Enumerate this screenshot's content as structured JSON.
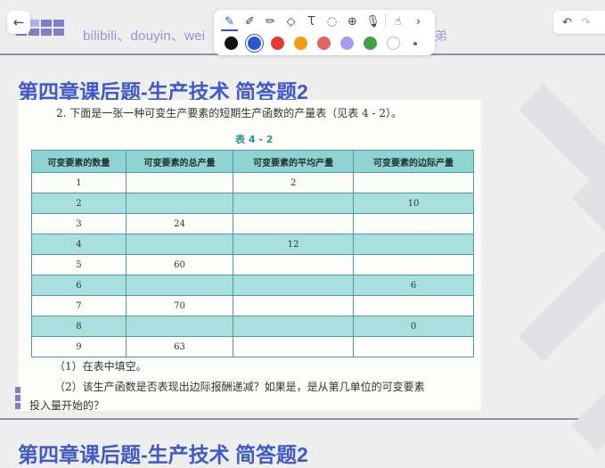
{
  "header": {
    "links": "bilibili、douyin、wei",
    "tail": "弟"
  },
  "slide": {
    "title": "第四章课后题-生产技术 简答题2",
    "title_repeat": "第四章课后题-生产技术 简答题2"
  },
  "toolbar": {
    "back_icon": "←",
    "tools": [
      {
        "name": "pen-icon",
        "glyph": "✎"
      },
      {
        "name": "highlighter-icon",
        "glyph": "✐"
      },
      {
        "name": "marker-icon",
        "glyph": "✏"
      },
      {
        "name": "eraser-icon",
        "glyph": "◇"
      },
      {
        "name": "text-icon",
        "glyph": "Ꚍ"
      },
      {
        "name": "lasso-icon",
        "glyph": "◌"
      },
      {
        "name": "add-icon",
        "glyph": "⊕"
      },
      {
        "name": "mic-icon",
        "glyph": "🎙"
      },
      {
        "name": "hand-icon",
        "glyph": "☝"
      },
      {
        "name": "chevron-right-icon",
        "glyph": "›"
      }
    ],
    "colors": [
      "#111111",
      "#2c55d6",
      "#e53935",
      "#f39c12",
      "#e06666",
      "#a89cf0",
      "#43a047",
      "#ffffff"
    ],
    "selected_color": "#2c55d6",
    "undo_icon": "↶",
    "redo_icon": "↷"
  },
  "scan": {
    "question": "2. 下面是一张一种可变生产要素的短期生产函数的产量表（见表 4 - 2）。",
    "caption": "表 4 - 2",
    "headers": [
      "可变要素的数量",
      "可变要素的总产量",
      "可变要素的平均产量",
      "可变要素的边际产量"
    ],
    "rows": [
      [
        "1",
        "",
        "2",
        ""
      ],
      [
        "2",
        "",
        "",
        "10"
      ],
      [
        "3",
        "24",
        "",
        ""
      ],
      [
        "4",
        "",
        "12",
        ""
      ],
      [
        "5",
        "60",
        "",
        ""
      ],
      [
        "6",
        "",
        "",
        "6"
      ],
      [
        "7",
        "70",
        "",
        ""
      ],
      [
        "8",
        "",
        "",
        "0"
      ],
      [
        "9",
        "63",
        "",
        ""
      ]
    ],
    "footnote1": "（1）在表中填空。",
    "footnote2": "（2）该生产函数是否表现出边际报酬递减？如果是，是从第几单位的可变要素",
    "footnote3": "投入量开始的？"
  }
}
